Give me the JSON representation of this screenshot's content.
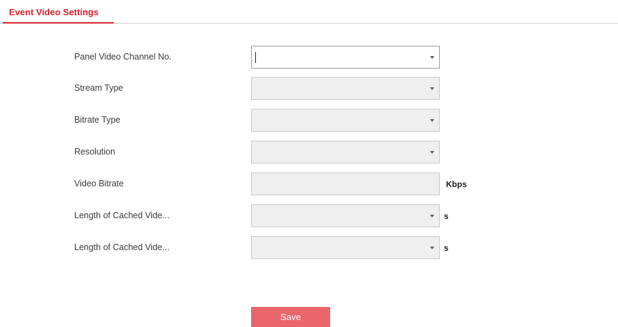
{
  "tabs": [
    {
      "label": "Event Video Settings",
      "active": true
    }
  ],
  "form": {
    "panel_video_channel": {
      "label": "Panel Video Channel No.",
      "value": ""
    },
    "stream_type": {
      "label": "Stream Type",
      "value": ""
    },
    "bitrate_type": {
      "label": "Bitrate Type",
      "value": ""
    },
    "resolution": {
      "label": "Resolution",
      "value": ""
    },
    "video_bitrate": {
      "label": "Video Bitrate",
      "value": "",
      "unit": "Kbps"
    },
    "cached_video_1": {
      "label": "Length of Cached Vide...",
      "value": "",
      "unit": "s"
    },
    "cached_video_2": {
      "label": "Length of Cached Vide...",
      "value": "",
      "unit": "s"
    }
  },
  "save_label": "Save",
  "colors": {
    "accent": "#d9242c",
    "save_button": "#e9666c",
    "disabled_field": "#efefef"
  },
  "icons": {
    "dropdown": "chevron-down-icon"
  }
}
